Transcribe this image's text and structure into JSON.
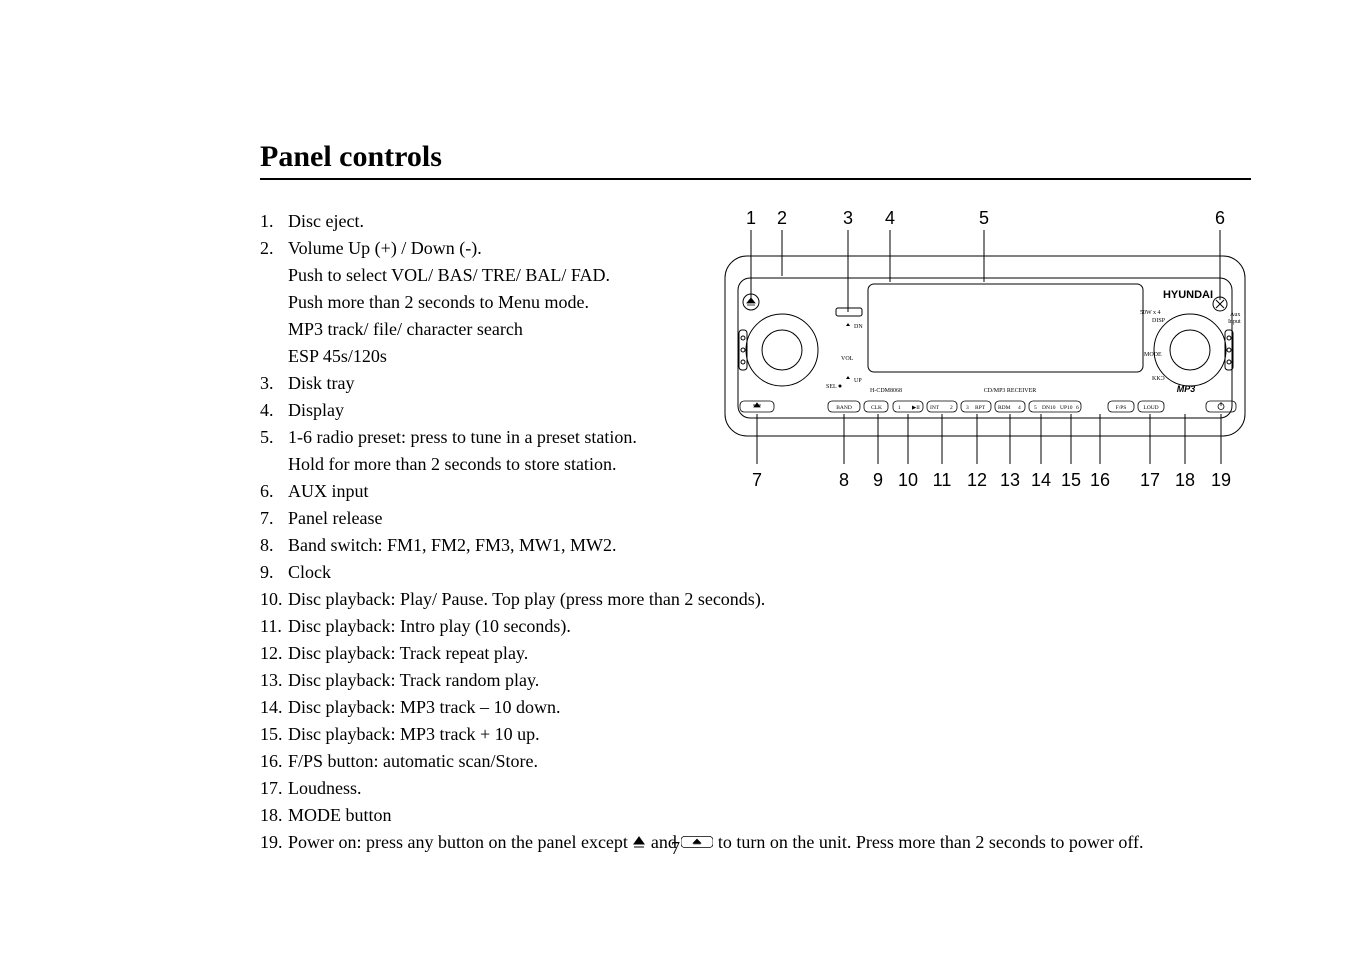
{
  "title": "Panel controls",
  "page_number": "7",
  "list": {
    "i1": {
      "text": "Disc eject."
    },
    "i2": {
      "text": "Volume Up (+) / Down (-).",
      "sub1": "Push to select VOL/ BAS/ TRE/ BAL/ FAD.",
      "sub2": "Push more than 2 seconds to Menu mode.",
      "sub3": "MP3 track/ file/ character search",
      "sub4": "ESP 45s/120s"
    },
    "i3": {
      "text": "Disk tray"
    },
    "i4": {
      "text": "Display"
    },
    "i5": {
      "text": "1-6 radio preset: press to tune in a preset station.",
      "sub1": "Hold for more than 2 seconds to store station."
    },
    "i6": {
      "text": "AUX input"
    },
    "i7": {
      "text": "Panel release"
    },
    "i8": {
      "text": "Band switch: FM1, FM2, FM3, MW1, MW2."
    },
    "i9": {
      "text": "Clock"
    },
    "i10": {
      "text": "Disc playback: Play/ Pause. Top play (press more than 2 seconds)."
    },
    "i11": {
      "text": "Disc playback: Intro play (10 seconds)."
    },
    "i12": {
      "text": "Disc playback: Track repeat play."
    },
    "i13": {
      "text": "Disc playback: Track random play."
    },
    "i14": {
      "text": "Disc playback: MP3 track – 10 down."
    },
    "i15": {
      "text": "Disc playback: MP3 track + 10 up."
    },
    "i16": {
      "text": "F/PS button: automatic scan/Store."
    },
    "i17": {
      "text": "Loudness."
    },
    "i18": {
      "text": "MODE button"
    },
    "i19": {
      "pre": "Power on: press any button on the panel except ",
      "mid": " and ",
      "post": " to turn on the unit. Press more than 2 seconds to power off."
    }
  },
  "figure": {
    "callouts": {
      "n1": "1",
      "n2": "2",
      "n3": "3",
      "n4": "4",
      "n5": "5",
      "n6": "6",
      "n7": "7",
      "n8": "8",
      "n9": "9",
      "n10": "10",
      "n11": "11",
      "n12": "12",
      "n13": "13",
      "n14": "14",
      "n15": "15",
      "n16": "16",
      "n17": "17",
      "n18": "18",
      "n19": "19"
    },
    "labels": {
      "brand": "HYUNDAI",
      "model": "H-CDM8068",
      "receiver": "CD/MP3 RECEIVER",
      "mp3": "MP3",
      "aux": "Aux\nInput",
      "kks": "KKƆ",
      "mode": "MODE",
      "dn": "DN",
      "disp": "DISP",
      "vol": "VOL",
      "up": "UP",
      "sel": "SEL",
      "sow": "50W x 4",
      "band": "BAND",
      "clk": "CLK",
      "p1a": "1",
      "p1b": "▶II",
      "p2a": "INT",
      "p2b": "2",
      "p3a": "3",
      "p3b": "RPT",
      "p4a": "RDM",
      "p4b": "4",
      "p5a": "5",
      "p5b": "DN10",
      "p6a": "UP10",
      "p6b": "6",
      "fps": "F/PS",
      "loud": "LOUD"
    }
  }
}
